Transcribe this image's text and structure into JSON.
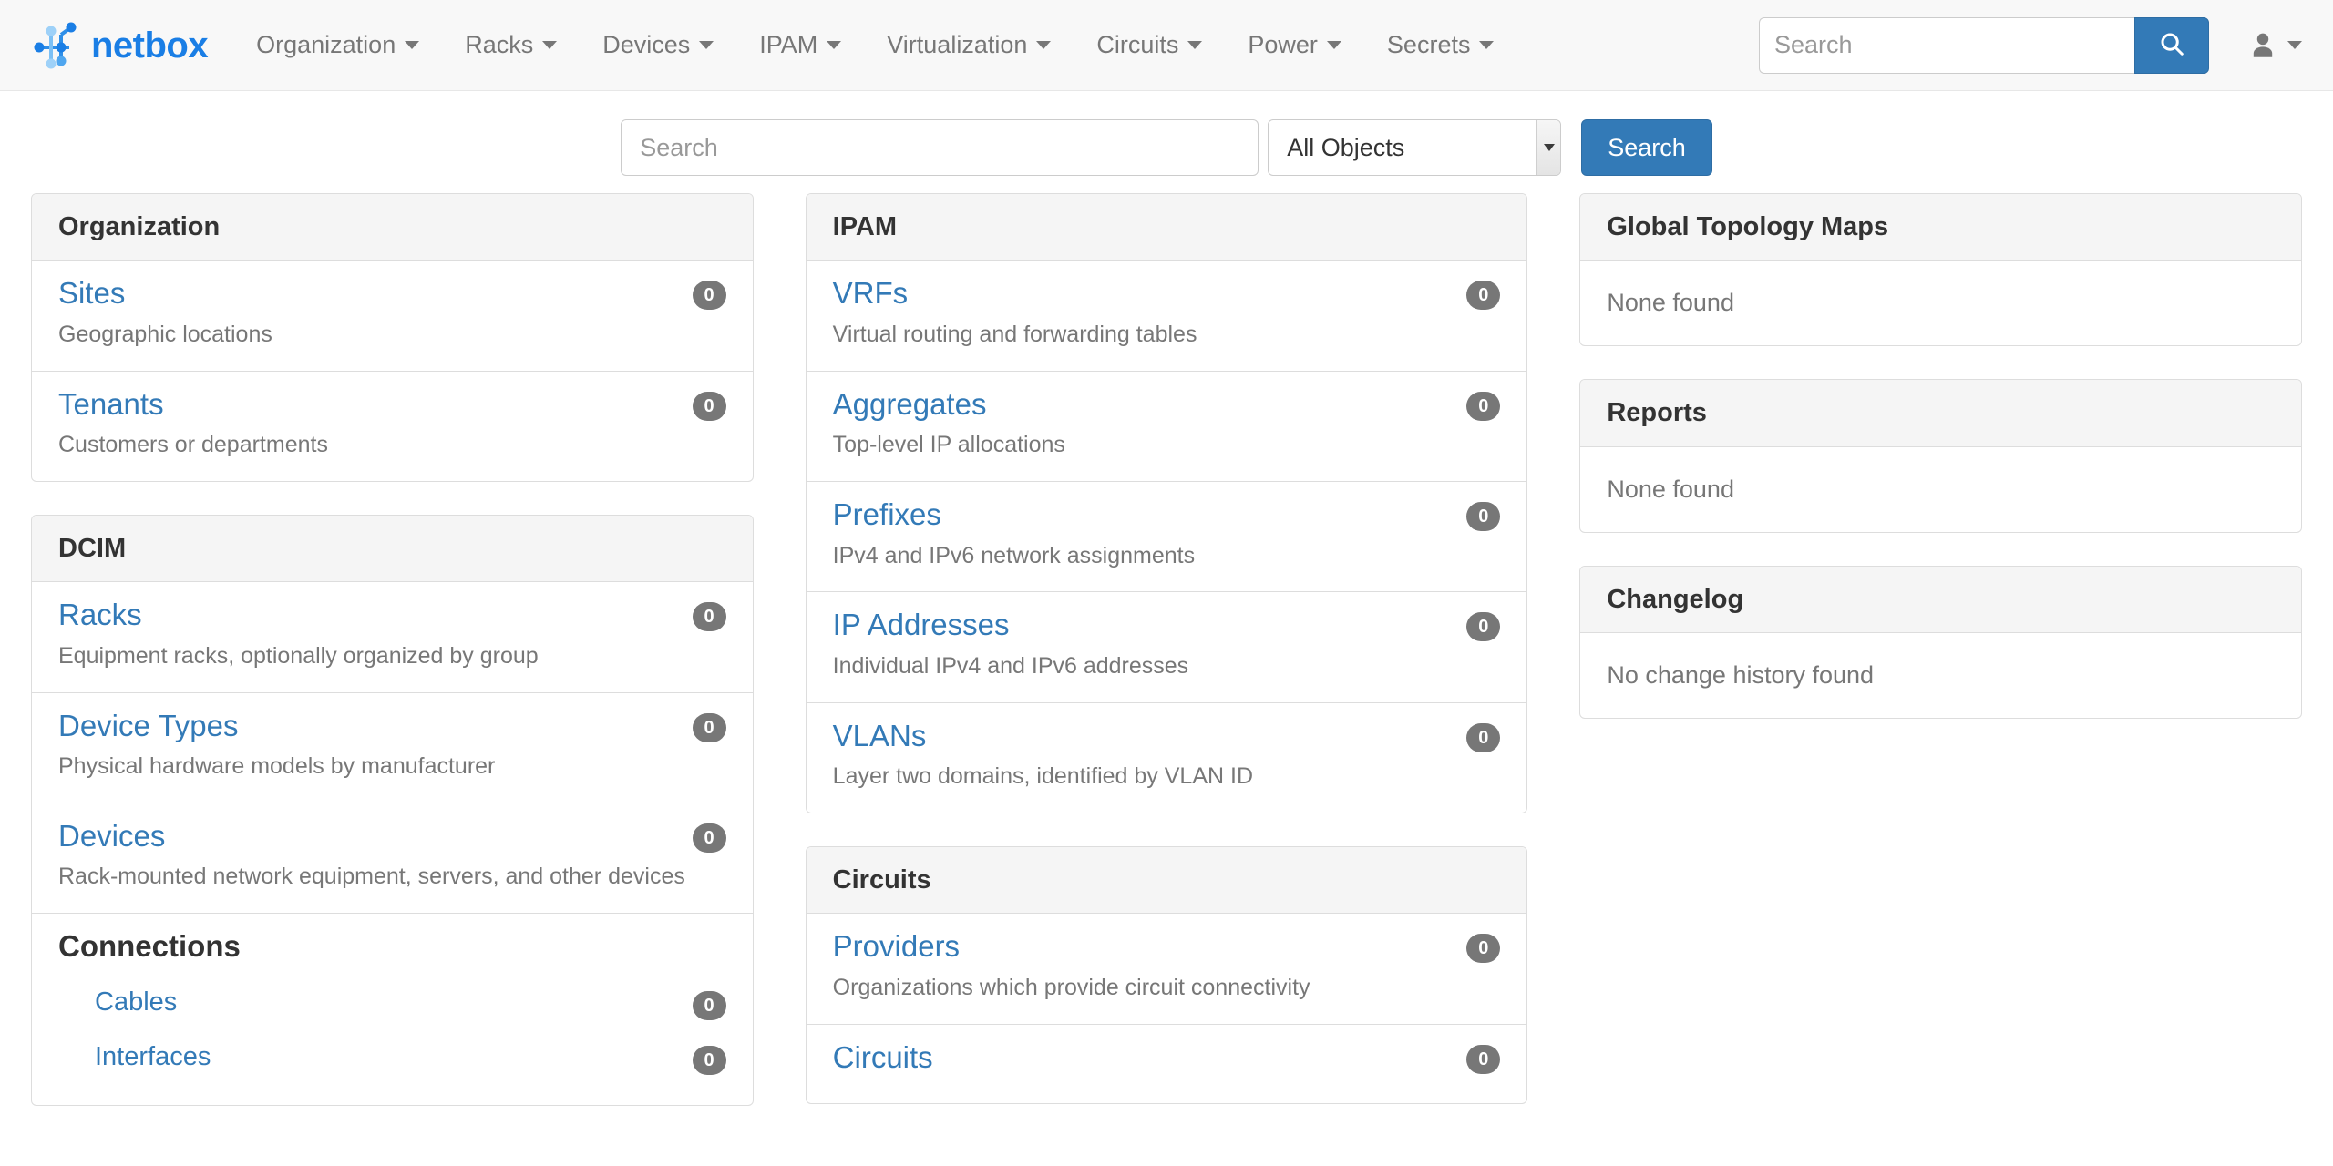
{
  "brand": {
    "name": "netbox",
    "logo_icon": "netbox-node-logo",
    "accent_color": "#1a7ee5"
  },
  "navbar": {
    "menus": [
      {
        "label": "Organization",
        "caret": true
      },
      {
        "label": "Racks",
        "caret": true
      },
      {
        "label": "Devices",
        "caret": true
      },
      {
        "label": "IPAM",
        "caret": true
      },
      {
        "label": "Virtualization",
        "caret": true
      },
      {
        "label": "Circuits",
        "caret": true
      },
      {
        "label": "Power",
        "caret": true
      },
      {
        "label": "Secrets",
        "caret": true
      }
    ],
    "search": {
      "placeholder": "Search",
      "value": "",
      "button_icon": "search-icon"
    },
    "user": {
      "icon": "user-icon",
      "caret_icon": "chevron-down-icon"
    }
  },
  "search_bar": {
    "input_placeholder": "Search",
    "input_value": "",
    "object_select_value": "All Objects",
    "object_select_options": [
      "All Objects"
    ],
    "submit_label": "Search"
  },
  "columns": {
    "left": [
      {
        "title": "Organization",
        "rows": [
          {
            "label": "Sites",
            "count": "0",
            "description": "Geographic locations"
          },
          {
            "label": "Tenants",
            "count": "0",
            "description": "Customers or departments"
          }
        ]
      },
      {
        "title": "DCIM",
        "rows": [
          {
            "label": "Racks",
            "count": "0",
            "description": "Equipment racks, optionally organized by group"
          },
          {
            "label": "Device Types",
            "count": "0",
            "description": "Physical hardware models by manufacturer"
          },
          {
            "label": "Devices",
            "count": "0",
            "description": "Rack-mounted network equipment, servers, and other devices"
          }
        ],
        "subsection": {
          "heading": "Connections",
          "items": [
            {
              "label": "Cables",
              "count": "0"
            },
            {
              "label": "Interfaces",
              "count": "0"
            }
          ]
        }
      }
    ],
    "middle": [
      {
        "title": "IPAM",
        "rows": [
          {
            "label": "VRFs",
            "count": "0",
            "description": "Virtual routing and forwarding tables"
          },
          {
            "label": "Aggregates",
            "count": "0",
            "description": "Top-level IP allocations"
          },
          {
            "label": "Prefixes",
            "count": "0",
            "description": "IPv4 and IPv6 network assignments"
          },
          {
            "label": "IP Addresses",
            "count": "0",
            "description": "Individual IPv4 and IPv6 addresses"
          },
          {
            "label": "VLANs",
            "count": "0",
            "description": "Layer two domains, identified by VLAN ID"
          }
        ]
      },
      {
        "title": "Circuits",
        "rows": [
          {
            "label": "Providers",
            "count": "0",
            "description": "Organizations which provide circuit connectivity"
          },
          {
            "label": "Circuits",
            "count": "0",
            "description": ""
          }
        ]
      }
    ],
    "right": [
      {
        "title": "Global Topology Maps",
        "empty_text": "None found"
      },
      {
        "title": "Reports",
        "empty_text": "None found"
      },
      {
        "title": "Changelog",
        "empty_text": "No change history found"
      }
    ]
  }
}
